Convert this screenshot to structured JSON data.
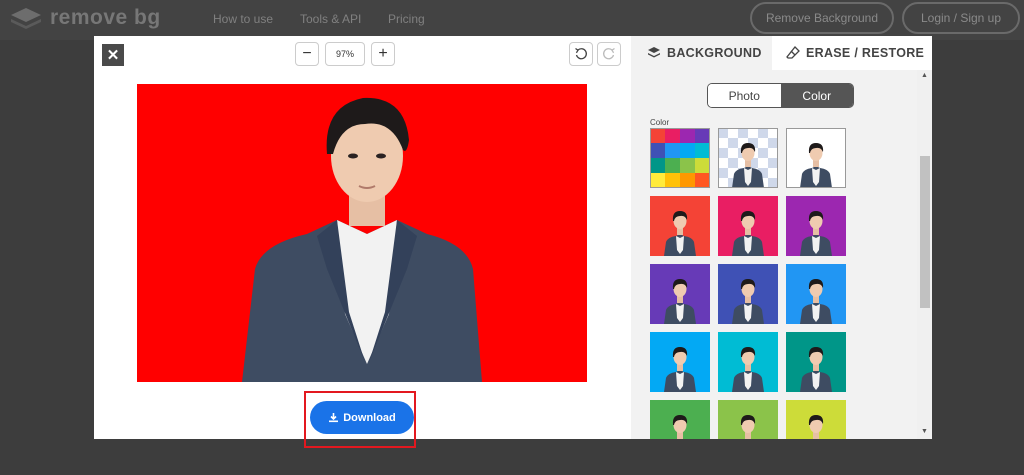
{
  "nav": {
    "logo_text": "remove bg",
    "links": [
      "How to use",
      "Tools & API",
      "Pricing"
    ],
    "remove_bg_button": "Remove Background",
    "login_button": "Login / Sign up"
  },
  "editor": {
    "close_icon": "close-icon",
    "zoom_value": "97%",
    "zoom_out_icon": "minus-icon",
    "zoom_in_icon": "plus-icon",
    "undo_icon": "undo-icon",
    "redo_icon": "redo-icon",
    "canvas_background": "#ff0000",
    "download_label": "Download"
  },
  "panel": {
    "tabs": [
      {
        "label": "BACKGROUND",
        "icon": "layers-icon"
      },
      {
        "label": "ERASE / RESTORE",
        "icon": "eraser-icon"
      }
    ],
    "toggle": {
      "photo": "Photo",
      "color": "Color"
    },
    "color_label": "Color",
    "swatches": [
      {
        "type": "palette"
      },
      {
        "type": "transparent",
        "color": "#cfd8ea"
      },
      {
        "type": "solid",
        "color": "#ffffff"
      },
      {
        "type": "solid",
        "color": "#f44336"
      },
      {
        "type": "solid",
        "color": "#e91e63"
      },
      {
        "type": "solid",
        "color": "#9c27b0"
      },
      {
        "type": "solid",
        "color": "#673ab7"
      },
      {
        "type": "solid",
        "color": "#3f51b5"
      },
      {
        "type": "solid",
        "color": "#2196f3"
      },
      {
        "type": "solid",
        "color": "#03a9f4"
      },
      {
        "type": "solid",
        "color": "#00bcd4"
      },
      {
        "type": "solid",
        "color": "#009688"
      },
      {
        "type": "solid",
        "color": "#4caf50"
      },
      {
        "type": "solid",
        "color": "#8bc34a"
      },
      {
        "type": "solid",
        "color": "#cddc39"
      }
    ]
  }
}
